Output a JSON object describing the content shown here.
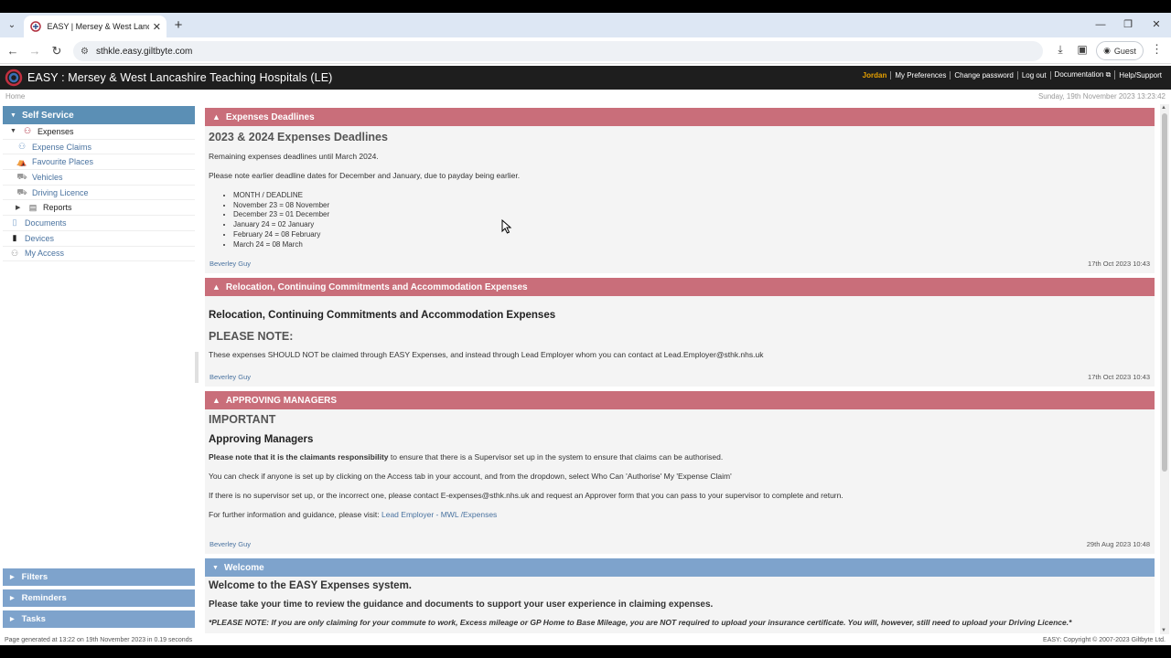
{
  "browser": {
    "tab_title": "EASY | Mersey & West Lancashire",
    "url": "sthkle.easy.giltbyte.com",
    "guest_label": "Guest"
  },
  "app": {
    "title": "EASY : Mersey & West Lancashire Teaching Hospitals (LE)",
    "user": "Jordan",
    "links": [
      "My Preferences",
      "Change password",
      "Log out",
      "Documentation ⧉",
      "Help/Support"
    ],
    "breadcrumb": "Home",
    "date": "Sunday, 19th November 2023 13:23:42"
  },
  "sidebar": {
    "section": "Self Service",
    "items": [
      {
        "label": "Expenses",
        "icon": "expenses-icon"
      },
      {
        "label": "Expense Claims",
        "icon": "claims-icon"
      },
      {
        "label": "Favourite Places",
        "icon": "places-icon"
      },
      {
        "label": "Vehicles",
        "icon": "vehicle-icon"
      },
      {
        "label": "Driving Licence",
        "icon": "licence-icon"
      },
      {
        "label": "Reports",
        "icon": "reports-icon"
      },
      {
        "label": "Documents",
        "icon": "document-icon"
      },
      {
        "label": "Devices",
        "icon": "device-icon"
      },
      {
        "label": "My Access",
        "icon": "access-icon"
      }
    ],
    "panels": [
      "Filters",
      "Reminders",
      "Tasks"
    ]
  },
  "notices": {
    "n1": {
      "header": "Expenses Deadlines",
      "heading": "2023 & 2024 Expenses Deadlines",
      "p1": "Remaining expenses deadlines until March 2024.",
      "p2": "Please note earlier deadline dates for December and January, due to payday being earlier.",
      "bullets": [
        "MONTH / DEADLINE",
        "November 23 = 08 November",
        "December 23 = 01 December",
        "January 24 = 02 January",
        "February 24 = 08 February",
        "March 24 = 08 March"
      ],
      "author": "Beverley Guy",
      "timestamp": "17th Oct 2023 10:43"
    },
    "n2": {
      "header": "Relocation, Continuing Commitments and Accommodation Expenses",
      "heading": "Relocation, Continuing Commitments and Accommodation Expenses",
      "note": "PLEASE NOTE:",
      "p1": "These expenses SHOULD NOT be claimed through EASY Expenses, and instead through Lead Employer whom you can contact at Lead.Employer@sthk.nhs.uk",
      "author": "Beverley Guy",
      "timestamp": "17th Oct 2023 10:43"
    },
    "n3": {
      "header": "APPROVING MANAGERS",
      "important": "IMPORTANT",
      "heading": "Approving Managers",
      "p1_bold": "Please note that it is the claimants responsibility",
      "p1_rest": " to ensure that there is a Supervisor set up in the system to ensure that claims can be authorised.",
      "p2": "You can check if anyone is set up by clicking on the Access tab in your account, and from the dropdown, select Who Can 'Authorise' My 'Expense Claim'",
      "p3": "If there is no supervisor set up, or the incorrect one, please contact E-expenses@sthk.nhs.uk and request an Approver form that you can pass to your supervisor to complete and return.",
      "p4_text": "For further information and guidance, please visit: ",
      "p4_link": "Lead Employer - MWL /Expenses",
      "author": "Beverley Guy",
      "timestamp": "29th Aug 2023 10:48"
    },
    "n4": {
      "header": "Welcome",
      "heading": "Welcome to the EASY Expenses system.",
      "sub": "Please take your time to review the guidance and documents to support your user experience in claiming expenses.",
      "note": "*PLEASE NOTE: If you are only claiming for your commute to work, Excess mileage or GP Home to Base Mileage, you are NOT required to upload your insurance certificate. You will, however, still need to upload your Driving Licence.*"
    }
  },
  "status": {
    "left": "Page generated at 13:22 on 19th November 2023 in 0.19 seconds",
    "right": "EASY: Copyright © 2007-2023 Giltbyte Ltd."
  },
  "colors": {
    "red_header": "#c96e7a",
    "blue_header": "#7ea3cc",
    "sidebar_head": "#5b8fb5"
  }
}
